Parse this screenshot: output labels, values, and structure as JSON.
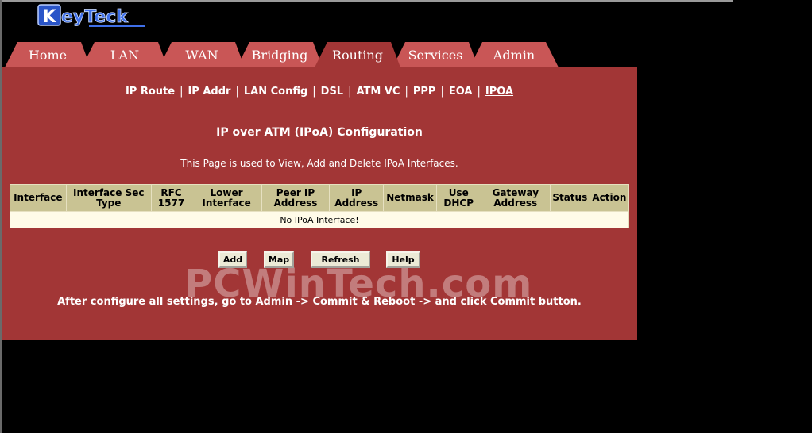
{
  "colors": {
    "panel": "#a23636",
    "tab": "#c95656",
    "tab_active": "#a23636",
    "header_cell": "#c9c393",
    "row_cell": "#fffbe8"
  },
  "logo": {
    "text": "KeyTeck"
  },
  "tabs": [
    {
      "label": "Home",
      "active": false
    },
    {
      "label": "LAN",
      "active": false
    },
    {
      "label": "WAN",
      "active": false
    },
    {
      "label": "Bridging",
      "active": false
    },
    {
      "label": "Routing",
      "active": true
    },
    {
      "label": "Services",
      "active": false
    },
    {
      "label": "Admin",
      "active": false
    }
  ],
  "subnav": [
    {
      "label": "IP Route",
      "active": false
    },
    {
      "label": "IP Addr",
      "active": false
    },
    {
      "label": "LAN Config",
      "active": false
    },
    {
      "label": "DSL",
      "active": false
    },
    {
      "label": "ATM VC",
      "active": false
    },
    {
      "label": "PPP",
      "active": false
    },
    {
      "label": "EOA",
      "active": false
    },
    {
      "label": "IPOA",
      "active": true
    }
  ],
  "subnav_separator": "|",
  "page": {
    "title": "IP over ATM (IPoA) Configuration",
    "description": "This Page is used to View, Add and Delete IPoA Interfaces."
  },
  "table": {
    "headers": [
      "Interface",
      "Interface Sec Type",
      "RFC 1577",
      "Lower Interface",
      "Peer IP Address",
      "IP Address",
      "Netmask",
      "Use DHCP",
      "Gateway Address",
      "Status",
      "Action"
    ],
    "empty_message": "No IPoA Interface!"
  },
  "buttons": {
    "add": "Add",
    "map": "Map",
    "refresh": "Refresh",
    "help": "Help"
  },
  "note": "After configure all settings, go to Admin -> Commit & Reboot -> and click Commit button.",
  "watermark": "PCWinTech.com"
}
